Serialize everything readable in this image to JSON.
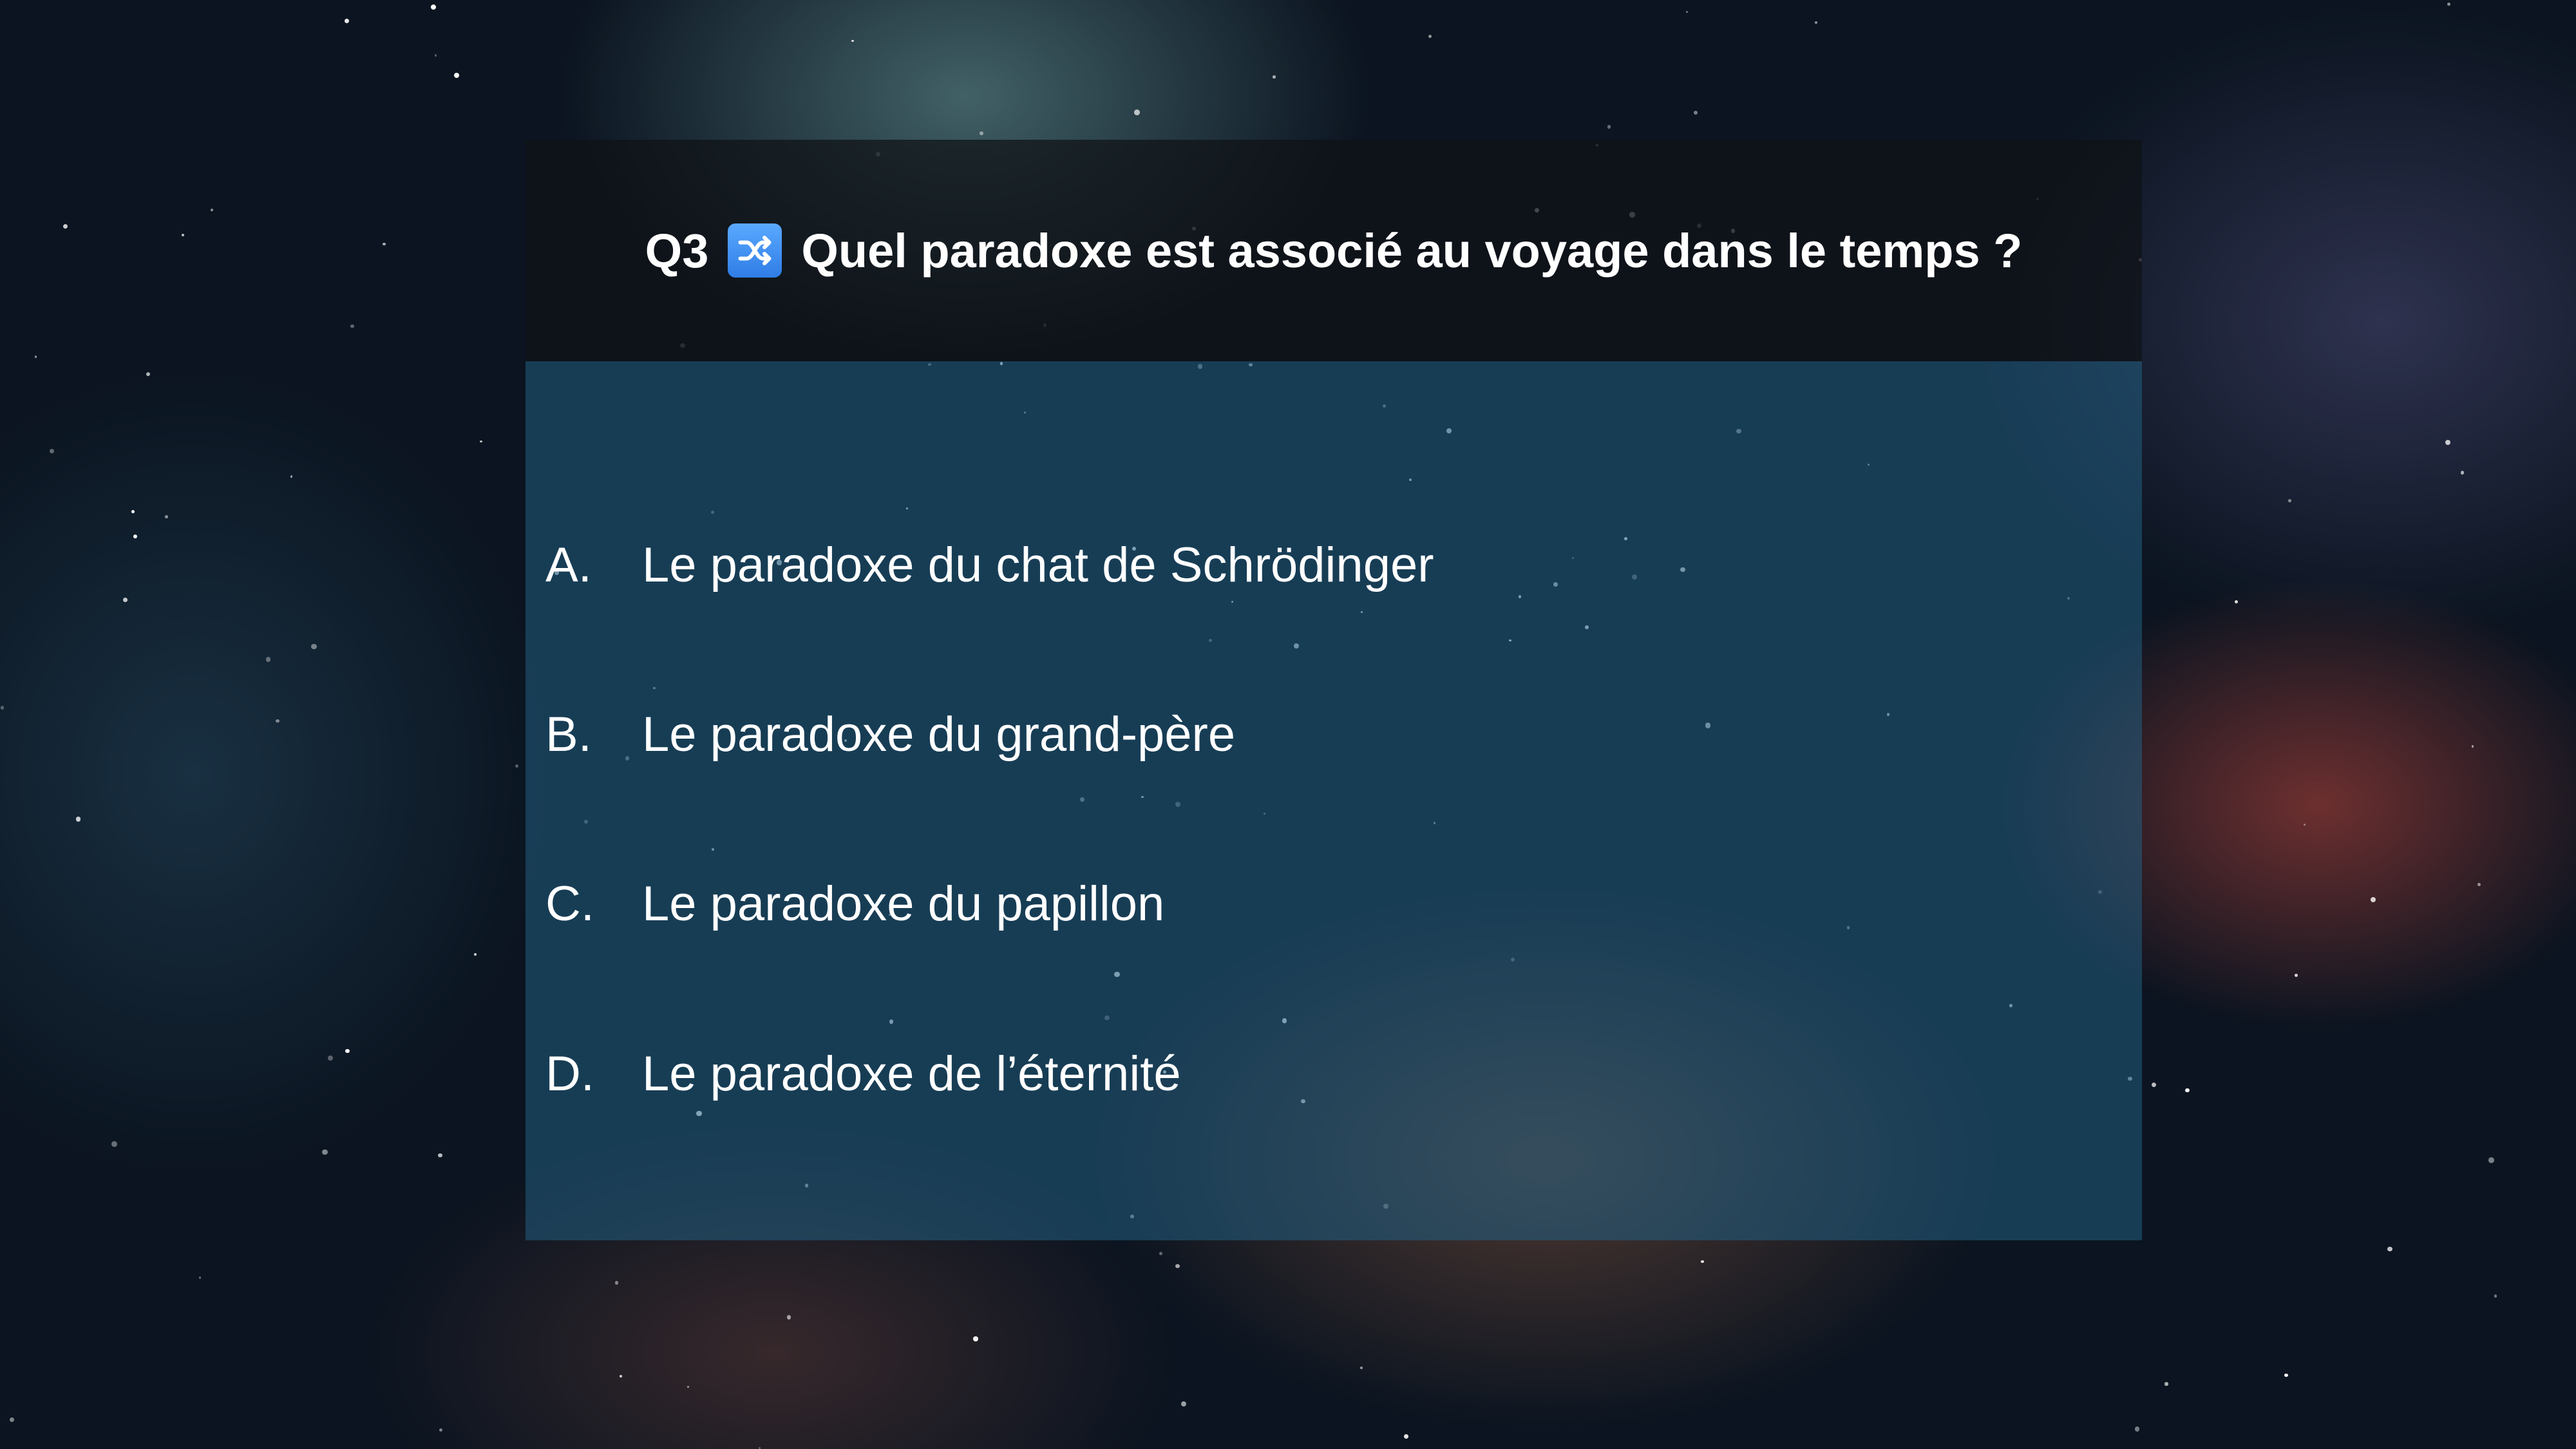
{
  "question": {
    "number": "Q3",
    "icon": "shuffle-icon",
    "text": "Quel paradoxe est associé au voyage dans le temps ?"
  },
  "answers": [
    {
      "letter": "A.",
      "text": "Le paradoxe du chat de Schrödinger"
    },
    {
      "letter": "B.",
      "text": "Le paradoxe du grand-père"
    },
    {
      "letter": "C.",
      "text": "Le paradoxe du papillon"
    },
    {
      "letter": "D.",
      "text": "Le paradoxe de l’éternité"
    }
  ],
  "colors": {
    "icon_bg": "#3d8ef0",
    "panel_body": "#235f82",
    "panel_header": "#0f1216"
  }
}
